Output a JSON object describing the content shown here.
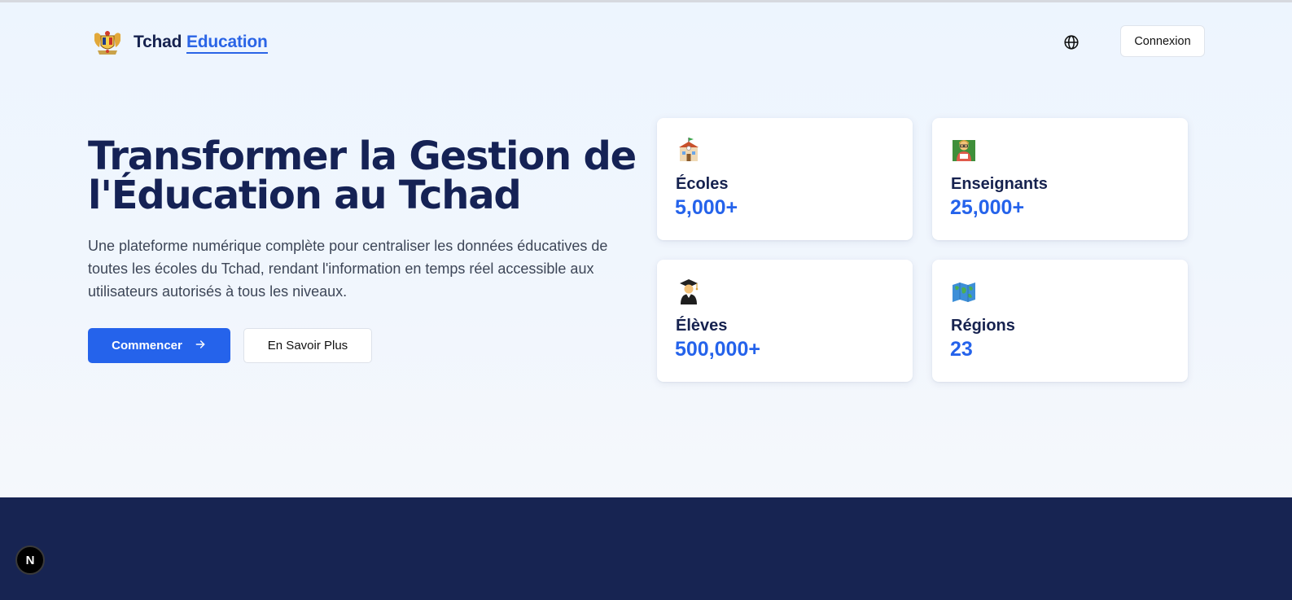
{
  "brand": {
    "name_prefix": "Tchad",
    "name_accent": "Education"
  },
  "header": {
    "login_label": "Connexion"
  },
  "hero": {
    "headline_line1": "Transformer la Gestion de",
    "headline_line2": "l'Éducation au Tchad",
    "description": "Une plateforme numérique complète pour centraliser les données éducatives de toutes les écoles du Tchad, rendant l'information en temps réel accessible aux utilisateurs autorisés à tous les niveaux.",
    "primary_label": "Commencer",
    "secondary_label": "En Savoir Plus"
  },
  "stats": [
    {
      "label": "Écoles",
      "value": "5,000+",
      "icon": "school-icon"
    },
    {
      "label": "Enseignants",
      "value": "25,000+",
      "icon": "teacher-icon"
    },
    {
      "label": "Élèves",
      "value": "500,000+",
      "icon": "graduate-icon"
    },
    {
      "label": "Régions",
      "value": "23",
      "icon": "map-icon"
    }
  ],
  "dev_badge": {
    "letter": "N"
  },
  "colors": {
    "accent": "#2563eb",
    "navy": "#152255",
    "footer": "#172452"
  }
}
